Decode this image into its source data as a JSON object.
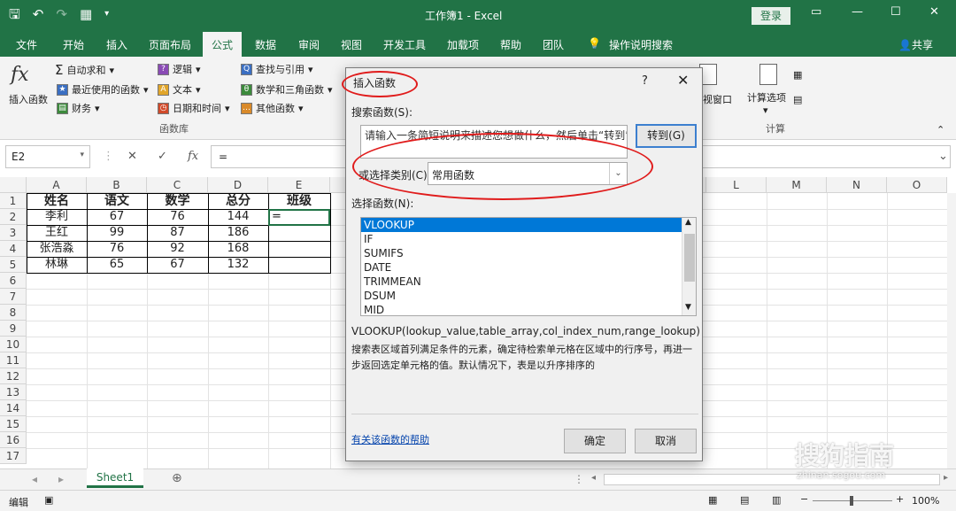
{
  "title": "工作簿1 - Excel",
  "login_label": "登录",
  "share_label": "共享",
  "menu_tabs": [
    "文件",
    "开始",
    "插入",
    "页面布局",
    "公式",
    "数据",
    "审阅",
    "视图",
    "开发工具",
    "加载项",
    "帮助",
    "团队",
    "操作说明搜索"
  ],
  "ribbon": {
    "insert_function": "插入函数",
    "autosum": "自动求和",
    "recent": "最近使用的函数",
    "finance": "财务",
    "logical": "逻辑",
    "text": "文本",
    "datetime": "日期和时间",
    "lookup": "查找与引用",
    "math": "数学和三角函数",
    "other": "其他函数",
    "library_group": "函数库",
    "watch_window": "视窗口",
    "calc_options": "计算选项",
    "calc_group": "计算"
  },
  "formula_bar": {
    "name_box": "E2",
    "formula": "="
  },
  "columns": [
    "A",
    "B",
    "C",
    "D",
    "E",
    "L",
    "M",
    "N",
    "O"
  ],
  "rows": [
    "1",
    "2",
    "3",
    "4",
    "5",
    "6",
    "7",
    "8",
    "9",
    "10",
    "11",
    "12",
    "13",
    "14",
    "15",
    "16",
    "17"
  ],
  "table": {
    "headers": [
      "姓名",
      "语文",
      "数学",
      "总分",
      "班级"
    ],
    "rows": [
      [
        "李利",
        "67",
        "76",
        "144",
        "="
      ],
      [
        "王红",
        "99",
        "87",
        "186",
        ""
      ],
      [
        "张浩淼",
        "76",
        "92",
        "168",
        ""
      ],
      [
        "林琳",
        "65",
        "67",
        "132",
        ""
      ]
    ]
  },
  "sheet_tab": "Sheet1",
  "status": {
    "mode": "编辑",
    "zoom": "100%"
  },
  "dialog": {
    "title": "插入函数",
    "help": "?",
    "search_label": "搜索函数(S):",
    "search_text": "请输入一条简短说明来描述您想做什么，然后单击“转到”",
    "goto_button": "转到(G)",
    "category_label": "或选择类别(C):",
    "category_value": "常用函数",
    "select_label": "选择函数(N):",
    "functions": [
      "VLOOKUP",
      "IF",
      "SUMIFS",
      "DATE",
      "TRIMMEAN",
      "DSUM",
      "MID"
    ],
    "signature": "VLOOKUP(lookup_value,table_array,col_index_num,range_lookup)",
    "description": "搜索表区域首列满足条件的元素，确定待检索单元格在区域中的行序号，再进一步返回选定单元格的值。默认情况下，表是以升序排序的",
    "help_link": "有关该函数的帮助",
    "ok_button": "确定",
    "cancel_button": "取消"
  },
  "watermark": "搜狗指南",
  "watermark_sub": "zhinan.sogou.com",
  "colors": {
    "excel_green": "#217346",
    "selection_blue": "#0078d7",
    "annotation_red": "#e01b1b"
  }
}
